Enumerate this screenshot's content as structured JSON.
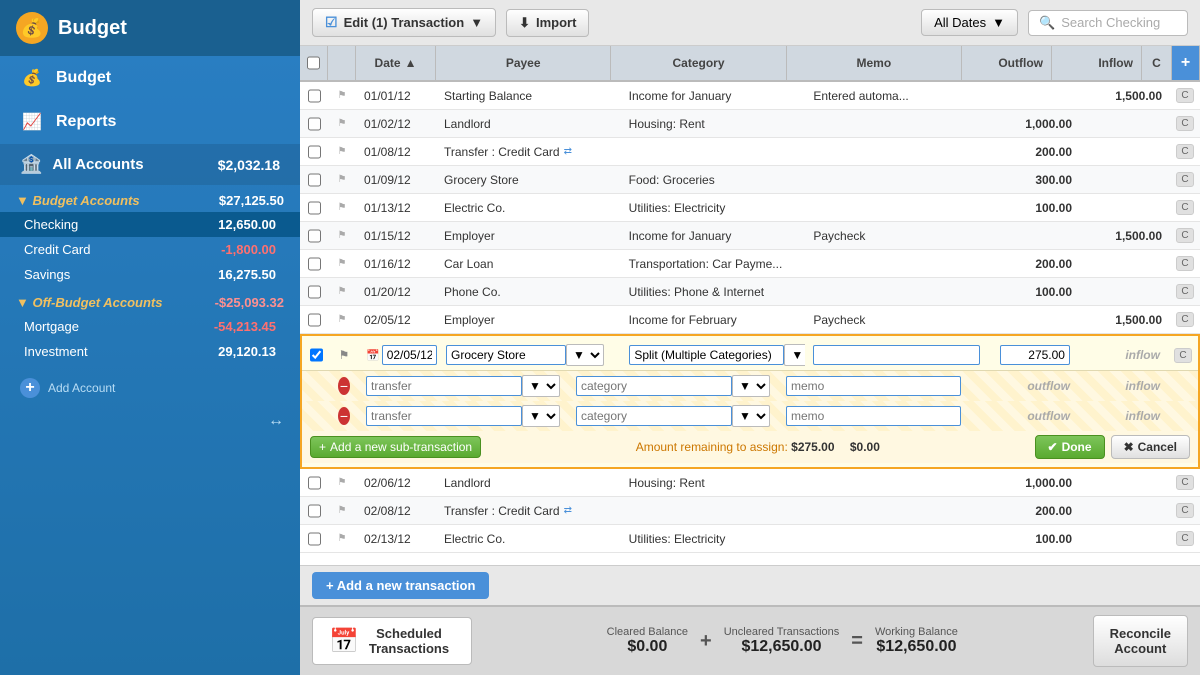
{
  "sidebar": {
    "logo": "Budget",
    "nav": [
      {
        "id": "budget",
        "label": "Budget",
        "icon": "💰"
      },
      {
        "id": "reports",
        "label": "Reports",
        "icon": "📈"
      },
      {
        "id": "all-accounts",
        "label": "All Accounts",
        "balance": "$2,032.18"
      }
    ],
    "budget_accounts": {
      "label": "Budget Accounts",
      "total": "$27,125.50",
      "items": [
        {
          "name": "Checking",
          "balance": "12,650.00",
          "negative": false,
          "active": true
        },
        {
          "name": "Credit Card",
          "balance": "-1,800.00",
          "negative": true
        },
        {
          "name": "Savings",
          "balance": "16,275.50",
          "negative": false
        }
      ]
    },
    "off_budget_accounts": {
      "label": "Off-Budget Accounts",
      "total": "-$25,093.32",
      "items": [
        {
          "name": "Mortgage",
          "balance": "-54,213.45",
          "negative": true
        },
        {
          "name": "Investment",
          "balance": "29,120.13",
          "negative": false
        }
      ]
    },
    "add_account": "Add Account"
  },
  "toolbar": {
    "edit_btn": "Edit (1) Transaction",
    "import_btn": "Import",
    "dates_btn": "All Dates",
    "search_placeholder": "Search Checking"
  },
  "table": {
    "headers": {
      "date": "Date",
      "payee": "Payee",
      "category": "Category",
      "memo": "Memo",
      "outflow": "Outflow",
      "inflow": "Inflow",
      "c": "C"
    },
    "rows": [
      {
        "date": "01/01/12",
        "payee": "Starting Balance",
        "category": "Income for January",
        "memo": "Entered automa...",
        "outflow": "",
        "inflow": "1,500.00"
      },
      {
        "date": "01/02/12",
        "payee": "Landlord",
        "category": "Housing: Rent",
        "memo": "",
        "outflow": "1,000.00",
        "inflow": ""
      },
      {
        "date": "01/08/12",
        "payee": "Transfer : Credit Card",
        "category": "",
        "memo": "",
        "outflow": "200.00",
        "inflow": "",
        "transfer": true
      },
      {
        "date": "01/09/12",
        "payee": "Grocery Store",
        "category": "Food: Groceries",
        "memo": "",
        "outflow": "300.00",
        "inflow": ""
      },
      {
        "date": "01/13/12",
        "payee": "Electric Co.",
        "category": "Utilities: Electricity",
        "memo": "",
        "outflow": "100.00",
        "inflow": ""
      },
      {
        "date": "01/15/12",
        "payee": "Employer",
        "category": "Income for January",
        "memo": "Paycheck",
        "outflow": "",
        "inflow": "1,500.00"
      },
      {
        "date": "01/16/12",
        "payee": "Car Loan",
        "category": "Transportation: Car Payme...",
        "memo": "",
        "outflow": "200.00",
        "inflow": ""
      },
      {
        "date": "01/20/12",
        "payee": "Phone Co.",
        "category": "Utilities: Phone & Internet",
        "memo": "",
        "outflow": "100.00",
        "inflow": ""
      },
      {
        "date": "02/05/12",
        "payee": "Employer",
        "category": "Income for February",
        "memo": "Paycheck",
        "outflow": "",
        "inflow": "1,500.00"
      }
    ],
    "editing_row": {
      "date": "02/05/12",
      "payee": "Grocery Store",
      "category": "Split (Multiple Categories)",
      "outflow": "275.00",
      "inflow": "inflow",
      "sub_rows": [
        {
          "payee_placeholder": "transfer",
          "category_placeholder": "category",
          "memo_placeholder": "memo",
          "outflow_placeholder": "outflow",
          "inflow_placeholder": "inflow"
        },
        {
          "payee_placeholder": "transfer",
          "category_placeholder": "category",
          "memo_placeholder": "memo",
          "outflow_placeholder": "outflow",
          "inflow_placeholder": "inflow"
        }
      ],
      "add_sub_label": "Add a new sub-transaction",
      "amount_remaining_label": "Amount remaining to assign:",
      "amount_remaining_outflow": "$275.00",
      "amount_remaining_inflow": "$0.00",
      "done_label": "Done",
      "cancel_label": "Cancel"
    },
    "post_rows": [
      {
        "date": "02/06/12",
        "payee": "Landlord",
        "category": "Housing: Rent",
        "memo": "",
        "outflow": "1,000.00",
        "inflow": ""
      },
      {
        "date": "02/08/12",
        "payee": "Transfer : Credit Card",
        "category": "",
        "memo": "",
        "outflow": "200.00",
        "inflow": "",
        "transfer": true
      },
      {
        "date": "02/13/12",
        "payee": "Electric Co.",
        "category": "Utilities: Electricity",
        "memo": "",
        "outflow": "100.00",
        "inflow": ""
      }
    ]
  },
  "bottom_bar": {
    "add_btn": "+ Add a new transaction"
  },
  "footer": {
    "scheduled_label": "Scheduled\nTransactions",
    "cleared_label": "Cleared Balance",
    "cleared_value": "$0.00",
    "plus": "+",
    "uncleared_label": "Uncleared Transactions",
    "uncleared_value": "$12,650.00",
    "equals": "=",
    "working_label": "Working Balance",
    "working_value": "$12,650.00",
    "reconcile_label": "Reconcile\nAccount"
  }
}
